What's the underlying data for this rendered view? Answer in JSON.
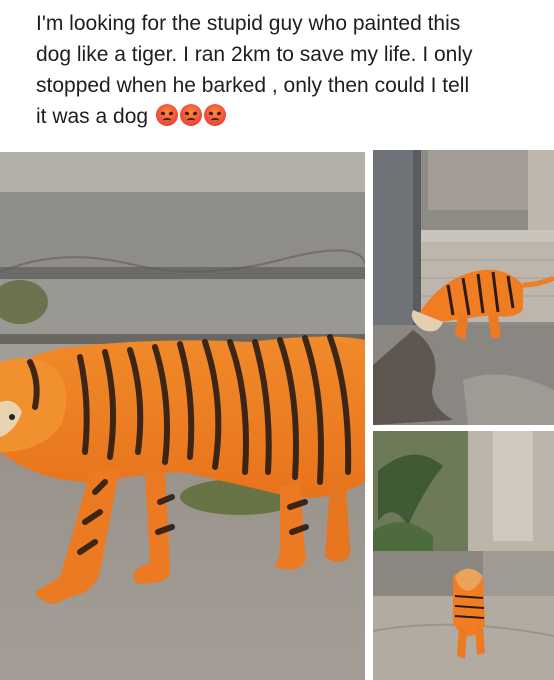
{
  "post": {
    "text_lines": [
      "I'm looking for the stupid guy who painted this",
      "dog like a tiger. I ran 2km to save my life. I only",
      "stopped when he barked , only then could I tell",
      "it was a dog"
    ],
    "trailing_emojis": [
      "angry-face-icon",
      "angry-face-icon",
      "angry-face-icon"
    ]
  },
  "photos": [
    {
      "subject": "tiger-striped-dog-closeup-photo"
    },
    {
      "subject": "tiger-striped-dog-by-wall-photo"
    },
    {
      "subject": "tiger-striped-dog-walking-photo"
    }
  ],
  "colors": {
    "dog_orange": "#f07d22",
    "stripe": "#2a1c14",
    "concrete": "#9a9792"
  }
}
